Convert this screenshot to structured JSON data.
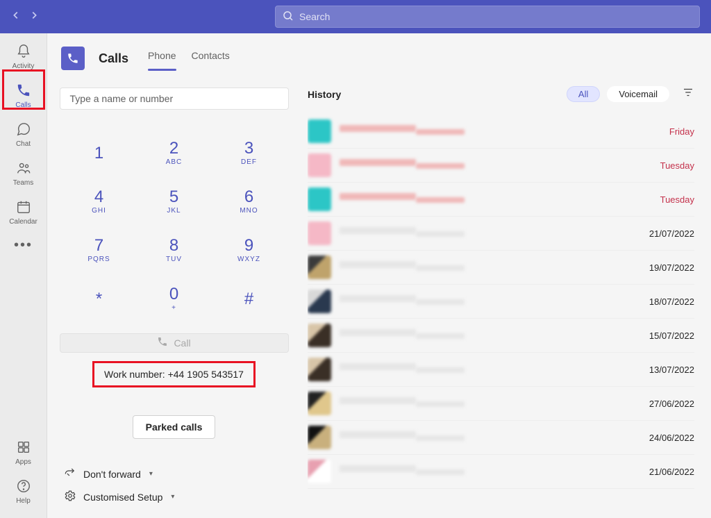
{
  "titlebar": {
    "search_placeholder": "Search"
  },
  "rail": {
    "activity": "Activity",
    "calls": "Calls",
    "chat": "Chat",
    "teams": "Teams",
    "calendar": "Calendar",
    "apps": "Apps",
    "help": "Help"
  },
  "header": {
    "title": "Calls",
    "tabs": {
      "phone": "Phone",
      "contacts": "Contacts"
    }
  },
  "dial": {
    "input_placeholder": "Type a name or number",
    "keys": [
      {
        "d": "1",
        "s": ""
      },
      {
        "d": "2",
        "s": "ABC"
      },
      {
        "d": "3",
        "s": "DEF"
      },
      {
        "d": "4",
        "s": "GHI"
      },
      {
        "d": "5",
        "s": "JKL"
      },
      {
        "d": "6",
        "s": "MNO"
      },
      {
        "d": "7",
        "s": "PQRS"
      },
      {
        "d": "8",
        "s": "TUV"
      },
      {
        "d": "9",
        "s": "WXYZ"
      },
      {
        "d": "*",
        "s": ""
      },
      {
        "d": "0",
        "s": "+"
      },
      {
        "d": "#",
        "s": ""
      }
    ],
    "call_label": "Call",
    "work_number": "Work number: +44 1905 543517",
    "parked_label": "Parked calls",
    "forward_label": "Don't forward",
    "setup_label": "Customised Setup"
  },
  "history": {
    "title": "History",
    "filters": {
      "all": "All",
      "voicemail": "Voicemail"
    },
    "items": [
      {
        "time": "Friday",
        "missed": true,
        "av": "av-teal"
      },
      {
        "time": "Tuesday",
        "missed": true,
        "av": "av-pink"
      },
      {
        "time": "Tuesday",
        "missed": true,
        "av": "av-teal"
      },
      {
        "time": "21/07/2022",
        "missed": false,
        "av": "av-pink"
      },
      {
        "time": "19/07/2022",
        "missed": false,
        "av": "av-d1"
      },
      {
        "time": "18/07/2022",
        "missed": false,
        "av": "av-d2"
      },
      {
        "time": "15/07/2022",
        "missed": false,
        "av": "av-d3"
      },
      {
        "time": "13/07/2022",
        "missed": false,
        "av": "av-d3"
      },
      {
        "time": "27/06/2022",
        "missed": false,
        "av": "av-d4"
      },
      {
        "time": "24/06/2022",
        "missed": false,
        "av": "av-d5"
      },
      {
        "time": "21/06/2022",
        "missed": false,
        "av": "av-d6"
      }
    ]
  }
}
